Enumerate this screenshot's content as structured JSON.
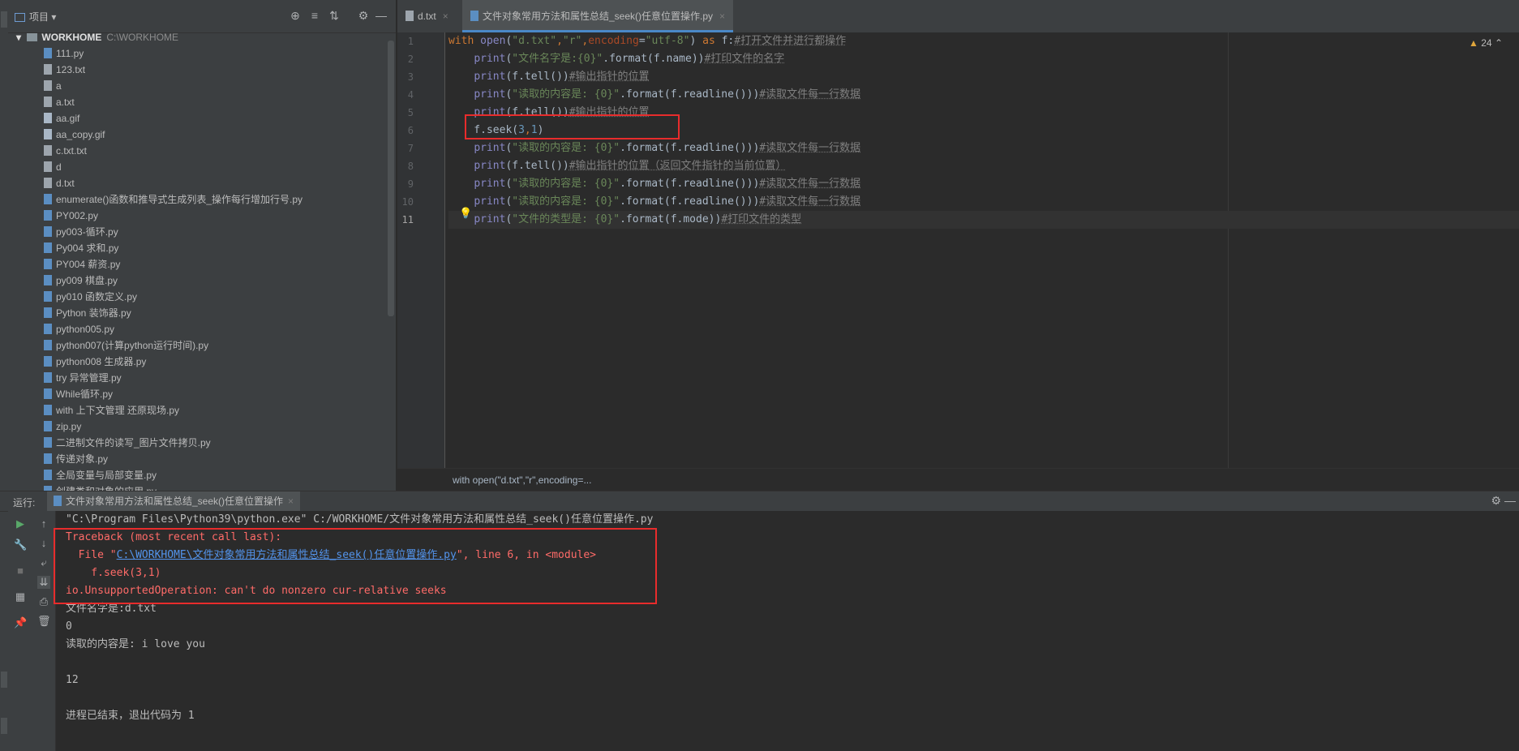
{
  "project_panel": {
    "title": "项目",
    "root_name": "WORKHOME",
    "root_path": "C:\\WORKHOME",
    "files": [
      {
        "name": "111.py",
        "type": "py"
      },
      {
        "name": "123.txt",
        "type": "txt"
      },
      {
        "name": "a",
        "type": "txt"
      },
      {
        "name": "a.txt",
        "type": "txt"
      },
      {
        "name": "aa.gif",
        "type": "gif"
      },
      {
        "name": "aa_copy.gif",
        "type": "gif"
      },
      {
        "name": "c.txt.txt",
        "type": "txt"
      },
      {
        "name": "d",
        "type": "txt"
      },
      {
        "name": "d.txt",
        "type": "txt"
      },
      {
        "name": "enumerate()函数和推导式生成列表_操作每行增加行号.py",
        "type": "py"
      },
      {
        "name": "PY002.py",
        "type": "py"
      },
      {
        "name": "py003-循环.py",
        "type": "py"
      },
      {
        "name": "Py004 求和.py",
        "type": "py"
      },
      {
        "name": "PY004  薪资.py",
        "type": "py"
      },
      {
        "name": "py009 棋盘.py",
        "type": "py"
      },
      {
        "name": "py010 函数定义.py",
        "type": "py"
      },
      {
        "name": "Python 装饰器.py",
        "type": "py"
      },
      {
        "name": "python005.py",
        "type": "py"
      },
      {
        "name": "python007(计算python运行时间).py",
        "type": "py"
      },
      {
        "name": "python008 生成器.py",
        "type": "py"
      },
      {
        "name": "try 异常管理.py",
        "type": "py"
      },
      {
        "name": "While循环.py",
        "type": "py"
      },
      {
        "name": "with 上下文管理 还原现场.py",
        "type": "py"
      },
      {
        "name": "zip.py",
        "type": "py"
      },
      {
        "name": "二进制文件的读写_图片文件拷贝.py",
        "type": "py"
      },
      {
        "name": "传递对象.py",
        "type": "py"
      },
      {
        "name": "全局变量与局部变量.py",
        "type": "py"
      },
      {
        "name": "创建类和对象的应用.py",
        "type": "py"
      }
    ]
  },
  "editor": {
    "tabs": [
      {
        "label": "d.txt",
        "active": false
      },
      {
        "label": "文件对象常用方法和属性总结_seek()任意位置操作.py",
        "active": true
      }
    ],
    "warning_count": "24",
    "breadcrumb": "with open(\"d.txt\",\"r\",encoding=...",
    "line_numbers": [
      "1",
      "2",
      "3",
      "4",
      "5",
      "6",
      "7",
      "8",
      "9",
      "10",
      "11"
    ],
    "lines": [
      "with open(\"d.txt\",\"r\",encoding=\"utf-8\") as f:#打开文件并进行都操作",
      "    print(\"文件名字是:{0}\".format(f.name))#打印文件的名字",
      "    print(f.tell())#输出指针的位置",
      "    print(\"读取的内容是: {0}\".format(f.readline()))#读取文件每一行数据",
      "    print(f.tell())#输出指针的位置",
      "    f.seek(3,1)",
      "    print(\"读取的内容是: {0}\".format(f.readline()))#读取文件每一行数据",
      "    print(f.tell())#输出指针的位置（返回文件指针的当前位置）",
      "    print(\"读取的内容是: {0}\".format(f.readline()))#读取文件每一行数据",
      "    print(\"读取的内容是: {0}\".format(f.readline()))#读取文件每一行数据",
      "    print(\"文件的类型是: {0}\".format(f.mode))#打印文件的类型"
    ]
  },
  "run_panel": {
    "label": "运行:",
    "tab_label": "文件对象常用方法和属性总结_seek()任意位置操作",
    "output": [
      {
        "text": "\"C:\\Program Files\\Python39\\python.exe\" C:/WORKHOME/文件对象常用方法和属性总结_seek()任意位置操作.py",
        "kind": "cmd"
      },
      {
        "text": "Traceback (most recent call last):",
        "kind": "err"
      },
      {
        "prefix": "  File \"",
        "link": "C:\\WORKHOME\\文件对象常用方法和属性总结_seek()任意位置操作.py",
        "suffix": "\", line 6, in <module>",
        "kind": "err-link"
      },
      {
        "text": "    f.seek(3,1)",
        "kind": "err"
      },
      {
        "text": "io.UnsupportedOperation: can't do nonzero cur-relative seeks",
        "kind": "err"
      },
      {
        "text": "文件名字是:d.txt",
        "kind": "out"
      },
      {
        "text": "0",
        "kind": "out"
      },
      {
        "text": "读取的内容是: i love you",
        "kind": "out"
      },
      {
        "text": "",
        "kind": "out"
      },
      {
        "text": "12",
        "kind": "out"
      },
      {
        "text": "",
        "kind": "out"
      },
      {
        "text": "进程已结束，退出代码为 1",
        "kind": "out"
      }
    ]
  },
  "colors": {
    "error": "#ff6b68",
    "highlight_box": "#e82c2c",
    "link": "#5394ec"
  }
}
